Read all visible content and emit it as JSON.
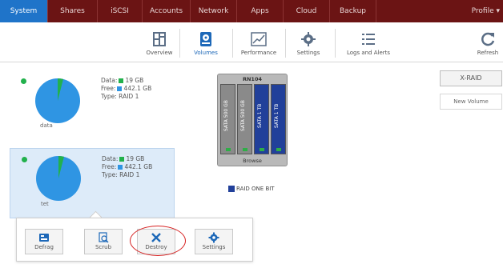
{
  "nav": {
    "items": [
      "System",
      "Shares",
      "iSCSI",
      "Accounts",
      "Network",
      "Apps",
      "Cloud",
      "Backup"
    ],
    "profile": "Profile ▾"
  },
  "toolbar": {
    "items": [
      {
        "label": "Overview",
        "icon": "overview-icon"
      },
      {
        "label": "Volumes",
        "icon": "volumes-icon"
      },
      {
        "label": "Performance",
        "icon": "performance-icon"
      },
      {
        "label": "Settings",
        "icon": "settings-gear-icon"
      },
      {
        "label": "Logs and Alerts",
        "icon": "logs-icon"
      }
    ],
    "refresh": "Refresh"
  },
  "volumes": [
    {
      "name": "data",
      "data_label": "Data:",
      "data_value": "19 GB",
      "free_label": "Free:",
      "free_value": "442.1 GB",
      "type_label": "Type:",
      "type_value": "RAID 1",
      "used_fraction": 0.04
    },
    {
      "name": "tet",
      "data_label": "Data:",
      "data_value": "19 GB",
      "free_label": "Free:",
      "free_value": "442.1 GB",
      "type_label": "Type:",
      "type_value": "RAID 1",
      "used_fraction": 0.04
    }
  ],
  "popup": {
    "buttons": [
      "Defrag",
      "Scrub",
      "Destroy",
      "Settings"
    ]
  },
  "enclosure": {
    "title": "RN104",
    "bays": [
      "SATA 500 GB",
      "SATA 500 GB",
      "SATA 1 TB",
      "SATA 1 TB"
    ],
    "browse": "Browse"
  },
  "raid_legend": "RAID ONE BIT",
  "right": {
    "xraid": "X-RAID",
    "new_volume": "New Volume"
  },
  "colors": {
    "nav_bg": "#6b1414",
    "active": "#1f74c9",
    "pie_free": "#2f95e3",
    "pie_used": "#22b14c",
    "highlight": "#d62020"
  }
}
